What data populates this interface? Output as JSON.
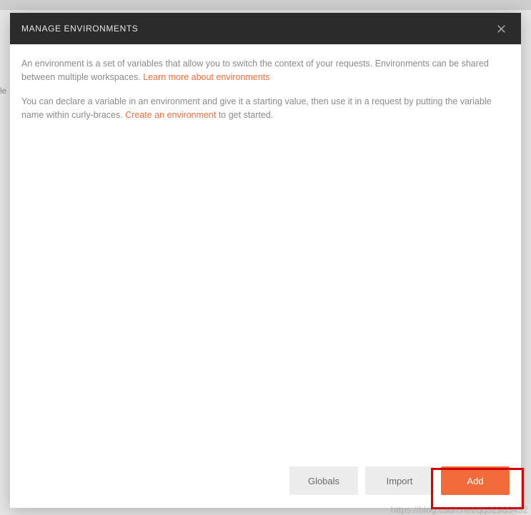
{
  "backdrop": {
    "fragment": "le"
  },
  "modal": {
    "title": "MANAGE ENVIRONMENTS",
    "para1_a": "An environment is a set of variables that allow you to switch the context of your requests. Environments can be shared between multiple workspaces. ",
    "para1_link": "Learn more about environments",
    "para2_a": "You can declare a variable in an environment and give it a starting value, then use it in a request by putting the variable name within curly-braces. ",
    "para2_link": "Create an environment",
    "para2_b": " to get started."
  },
  "footer": {
    "globals": "Globals",
    "import": "Import",
    "add": "Add"
  },
  "watermark": "https://blog.csdn.net/qq32933432"
}
